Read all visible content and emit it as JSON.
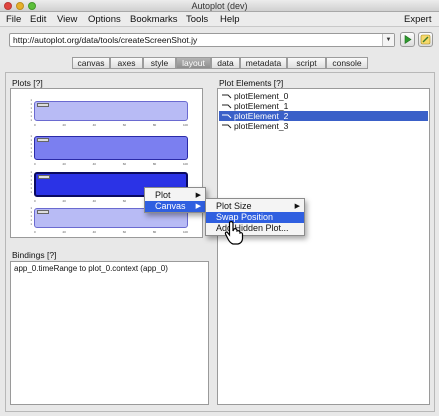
{
  "window": {
    "title": "Autoplot (dev)"
  },
  "menubar": {
    "items": [
      {
        "label": "File"
      },
      {
        "label": "Edit"
      },
      {
        "label": "View"
      },
      {
        "label": "Options"
      },
      {
        "label": "Bookmarks"
      },
      {
        "label": "Tools"
      },
      {
        "label": "Help"
      }
    ],
    "expert": "Expert"
  },
  "toolbar": {
    "url": "http://autoplot.org/data/tools/createScreenShot.jy",
    "dropdown_icon": "chevron-down-icon",
    "play_icon": "play-icon",
    "edit_icon": "edit-icon"
  },
  "tabs": [
    {
      "label": "canvas"
    },
    {
      "label": "axes"
    },
    {
      "label": "style"
    },
    {
      "label": "layout",
      "active": true
    },
    {
      "label": "data"
    },
    {
      "label": "metadata"
    },
    {
      "label": "script"
    },
    {
      "label": "console"
    }
  ],
  "plots_panel": {
    "title": "Plots [?]"
  },
  "bindings_panel": {
    "title": "Bindings [?]",
    "items": [
      "app_0.timeRange to plot_0.context  (app_0)"
    ]
  },
  "elements_panel": {
    "title": "Plot Elements [?]",
    "items": [
      {
        "label": "plotElement_0",
        "selected": false
      },
      {
        "label": "plotElement_1",
        "selected": false
      },
      {
        "label": "plotElement_2",
        "selected": true
      },
      {
        "label": "plotElement_3",
        "selected": false
      }
    ]
  },
  "context_menu": {
    "items": [
      {
        "label": "Plot",
        "has_submenu": true
      },
      {
        "label": "Canvas",
        "has_submenu": true,
        "highlighted": true
      }
    ],
    "submenu": [
      {
        "label": "Plot Size",
        "has_submenu": true
      },
      {
        "label": "Swap Position",
        "highlighted": true
      },
      {
        "label": "Add Hidden Plot..."
      }
    ]
  },
  "colors": {
    "selection": "#3a60c8",
    "menu_highlight": "#2f5fe0",
    "plot_fill": "#7b7ff0",
    "plot_selected": "#2b33e6"
  }
}
